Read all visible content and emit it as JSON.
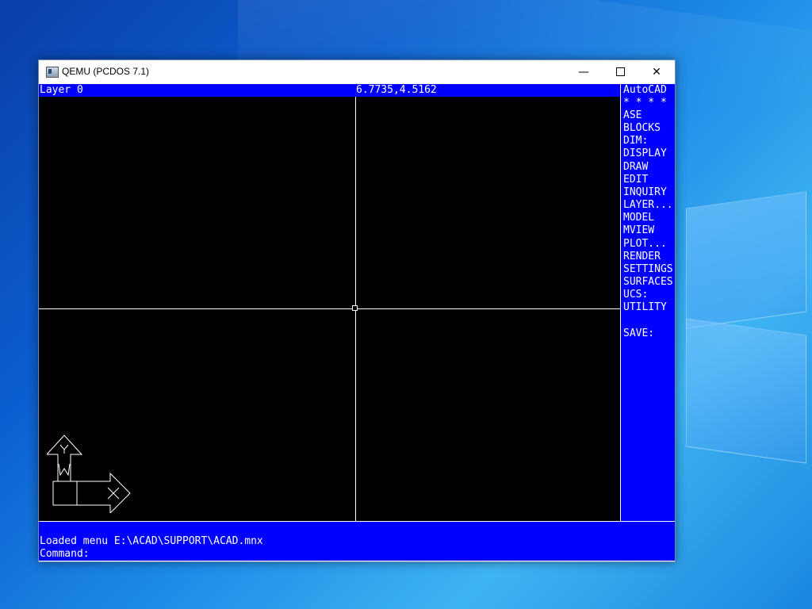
{
  "window": {
    "title": "QEMU (PCDOS 7.1)",
    "minimize_glyph": "—",
    "close_glyph": "✕",
    "icon": "qemu-app-icon"
  },
  "status": {
    "layer": "Layer 0",
    "coordinates": "6.7735,4.5162"
  },
  "menu": {
    "items": [
      "AutoCAD",
      "* * * *",
      "ASE",
      "BLOCKS",
      "DIM:",
      "DISPLAY",
      "DRAW",
      "EDIT",
      "INQUIRY",
      "LAYER...",
      "MODEL",
      "MVIEW",
      "PLOT...",
      "RENDER",
      "SETTINGS",
      "SURFACES",
      "UCS:",
      "UTILITY",
      "",
      "SAVE:"
    ]
  },
  "ucs_icon": {
    "y_label": "Y",
    "w_label": "W",
    "x_label": "X"
  },
  "command": {
    "history": "Loaded menu E:\\ACAD\\SUPPORT\\ACAD.mnx",
    "prompt": "Command:"
  },
  "colors": {
    "autocad_blue": "#0000ff",
    "drawing_bg": "#000000",
    "foreground": "#ffffff"
  }
}
